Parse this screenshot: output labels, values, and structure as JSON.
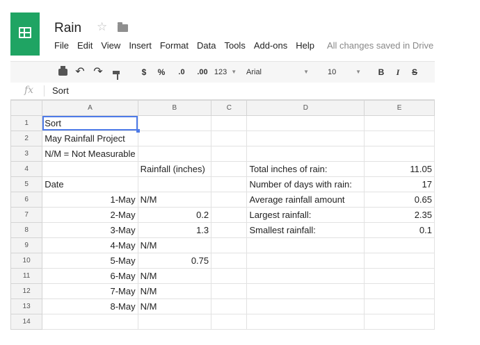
{
  "title": "Rain",
  "menu": [
    "File",
    "Edit",
    "View",
    "Insert",
    "Format",
    "Data",
    "Tools",
    "Add-ons",
    "Help"
  ],
  "save_status": "All changes saved in Drive",
  "toolbar": {
    "undo": "↶",
    "redo": "↷",
    "currency": "$",
    "percent": "%",
    "dec_decrease": ".0",
    "dec_increase": ".00",
    "more_formats": "123",
    "font": "Arial",
    "font_size": "10",
    "bold": "B",
    "italic": "I",
    "strike": "S"
  },
  "formula_bar": {
    "fx": "fx",
    "value": "Sort"
  },
  "columns": [
    "A",
    "B",
    "C",
    "D",
    "E"
  ],
  "rows": [
    [
      "Sort",
      "",
      "",
      "",
      ""
    ],
    [
      "May Rainfall Project",
      "",
      "",
      "",
      ""
    ],
    [
      "N/M = Not Measurable",
      "",
      "",
      "",
      ""
    ],
    [
      "",
      "Rainfall (inches)",
      "",
      "Total inches of rain:",
      "11.05"
    ],
    [
      "Date",
      "",
      "",
      "Number of days with rain:",
      "17"
    ],
    [
      "1-May",
      "N/M",
      "",
      "Average rainfall amount",
      "0.65"
    ],
    [
      "2-May",
      "0.2",
      "",
      "Largest rainfall:",
      "2.35"
    ],
    [
      "3-May",
      "1.3",
      "",
      "Smallest rainfall:",
      "0.1"
    ],
    [
      "4-May",
      "N/M",
      "",
      "",
      ""
    ],
    [
      "5-May",
      "0.75",
      "",
      "",
      ""
    ],
    [
      "6-May",
      "N/M",
      "",
      "",
      ""
    ],
    [
      "7-May",
      "N/M",
      "",
      "",
      ""
    ],
    [
      "8-May",
      "N/M",
      "",
      "",
      ""
    ],
    [
      "",
      "",
      "",
      "",
      ""
    ]
  ]
}
